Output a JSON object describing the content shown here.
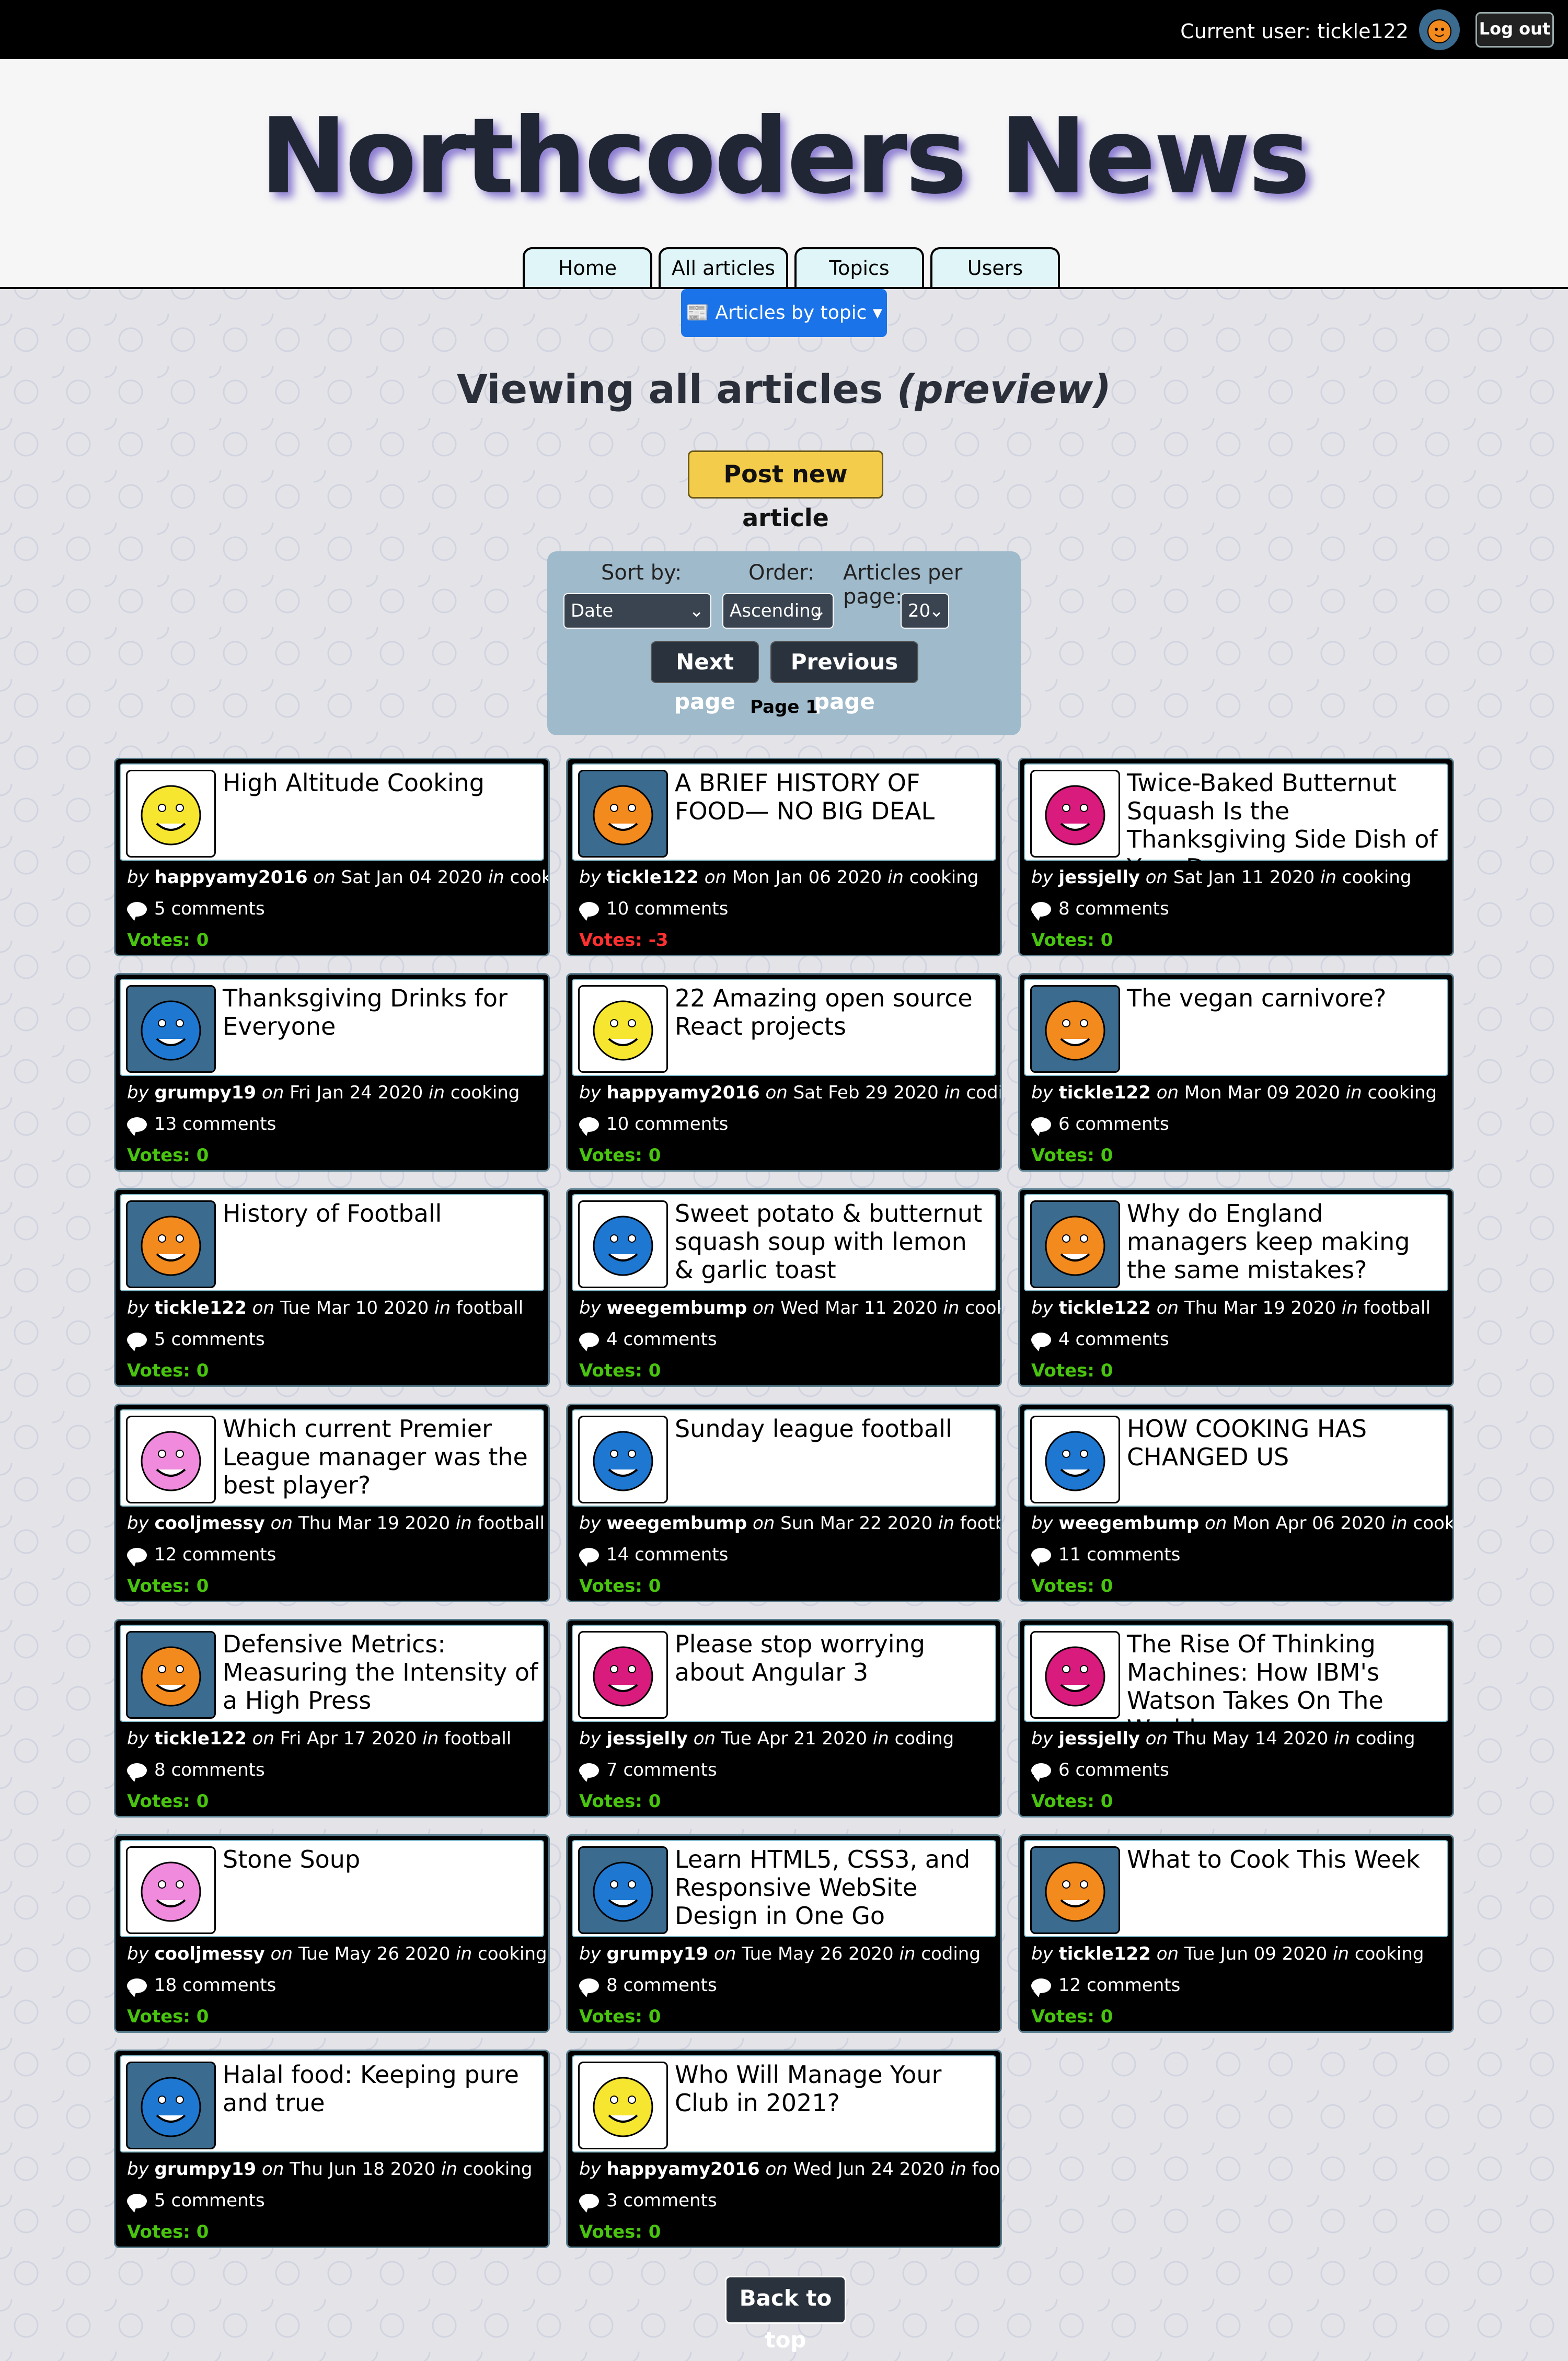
{
  "topbar": {
    "current_user": "Current user: tickle122",
    "logout_label": "Log out"
  },
  "header": {
    "title": "Northcoders News",
    "tabs": [
      "Home",
      "All articles",
      "Topics",
      "Users"
    ]
  },
  "topic_dropdown": {
    "label": "📰 Articles by topic ▾"
  },
  "page_heading": {
    "text": "Viewing all articles ",
    "emphasis": "(preview)"
  },
  "post_button": {
    "label": "Post new article"
  },
  "controls": {
    "sort_label": "Sort by:",
    "order_label": "Order:",
    "per_page_label": "Articles per page:",
    "sort_value": "Date",
    "order_value": "Ascending",
    "per_page_value": "20",
    "next_label": "Next page",
    "prev_label": "Previous page",
    "page_text": "Page 1"
  },
  "avatar_colors": {
    "happyamy2016": "#f7e630",
    "tickle122": "#f28a1e",
    "jessjelly": "#d81b7d",
    "grumpy19": "#1e78d2",
    "weegembump": "#1e78d2",
    "cooljmessy": "#f08adc"
  },
  "articles": [
    {
      "title": "High Altitude Cooking",
      "author": "happyamy2016",
      "date": "Sat Jan 04 2020",
      "topic": "cooking",
      "comments": "5 comments",
      "votes": "Votes: 0",
      "negative": false
    },
    {
      "title": "A BRIEF HISTORY OF FOOD— NO BIG DEAL",
      "author": "tickle122",
      "date": "Mon Jan 06 2020",
      "topic": "cooking",
      "comments": "10 comments",
      "votes": "Votes: -3",
      "negative": true
    },
    {
      "title": "Twice-Baked Butternut Squash Is the Thanksgiving Side Dish of Your Dreams",
      "author": "jessjelly",
      "date": "Sat Jan 11 2020",
      "topic": "cooking",
      "comments": "8 comments",
      "votes": "Votes: 0",
      "negative": false
    },
    {
      "title": "Thanksgiving Drinks for Everyone",
      "author": "grumpy19",
      "date": "Fri Jan 24 2020",
      "topic": "cooking",
      "comments": "13 comments",
      "votes": "Votes: 0",
      "negative": false
    },
    {
      "title": "22 Amazing open source React projects",
      "author": "happyamy2016",
      "date": "Sat Feb 29 2020",
      "topic": "coding",
      "comments": "10 comments",
      "votes": "Votes: 0",
      "negative": false
    },
    {
      "title": "The vegan carnivore?",
      "author": "tickle122",
      "date": "Mon Mar 09 2020",
      "topic": "cooking",
      "comments": "6 comments",
      "votes": "Votes: 0",
      "negative": false
    },
    {
      "title": "History of Football",
      "author": "tickle122",
      "date": "Tue Mar 10 2020",
      "topic": "football",
      "comments": "5 comments",
      "votes": "Votes: 0",
      "negative": false
    },
    {
      "title": "Sweet potato & butternut squash soup with lemon & garlic toast",
      "author": "weegembump",
      "date": "Wed Mar 11 2020",
      "topic": "cooking",
      "comments": "4 comments",
      "votes": "Votes: 0",
      "negative": false
    },
    {
      "title": "Why do England managers keep making the same mistakes?",
      "author": "tickle122",
      "date": "Thu Mar 19 2020",
      "topic": "football",
      "comments": "4 comments",
      "votes": "Votes: 0",
      "negative": false
    },
    {
      "title": "Which current Premier League manager was the best player?",
      "author": "cooljmessy",
      "date": "Thu Mar 19 2020",
      "topic": "football",
      "comments": "12 comments",
      "votes": "Votes: 0",
      "negative": false
    },
    {
      "title": "Sunday league football",
      "author": "weegembump",
      "date": "Sun Mar 22 2020",
      "topic": "football",
      "comments": "14 comments",
      "votes": "Votes: 0",
      "negative": false
    },
    {
      "title": "HOW COOKING HAS CHANGED US",
      "author": "weegembump",
      "date": "Mon Apr 06 2020",
      "topic": "cooking",
      "comments": "11 comments",
      "votes": "Votes: 0",
      "negative": false
    },
    {
      "title": "Defensive Metrics: Measuring the Intensity of a High Press",
      "author": "tickle122",
      "date": "Fri Apr 17 2020",
      "topic": "football",
      "comments": "8 comments",
      "votes": "Votes: 0",
      "negative": false
    },
    {
      "title": "Please stop worrying about Angular 3",
      "author": "jessjelly",
      "date": "Tue Apr 21 2020",
      "topic": "coding",
      "comments": "7 comments",
      "votes": "Votes: 0",
      "negative": false
    },
    {
      "title": "The Rise Of Thinking Machines: How IBM's Watson Takes On The World",
      "author": "jessjelly",
      "date": "Thu May 14 2020",
      "topic": "coding",
      "comments": "6 comments",
      "votes": "Votes: 0",
      "negative": false
    },
    {
      "title": "Stone Soup",
      "author": "cooljmessy",
      "date": "Tue May 26 2020",
      "topic": "cooking",
      "comments": "18 comments",
      "votes": "Votes: 0",
      "negative": false
    },
    {
      "title": "Learn HTML5, CSS3, and Responsive WebSite Design in One Go",
      "author": "grumpy19",
      "date": "Tue May 26 2020",
      "topic": "coding",
      "comments": "8 comments",
      "votes": "Votes: 0",
      "negative": false
    },
    {
      "title": "What to Cook This Week",
      "author": "tickle122",
      "date": "Tue Jun 09 2020",
      "topic": "cooking",
      "comments": "12 comments",
      "votes": "Votes: 0",
      "negative": false
    },
    {
      "title": "Halal food: Keeping pure and true",
      "author": "grumpy19",
      "date": "Thu Jun 18 2020",
      "topic": "cooking",
      "comments": "5 comments",
      "votes": "Votes: 0",
      "negative": false
    },
    {
      "title": "Who Will Manage Your Club in 2021?",
      "author": "happyamy2016",
      "date": "Wed Jun 24 2020",
      "topic": "football",
      "comments": "3 comments",
      "votes": "Votes: 0",
      "negative": false
    }
  ],
  "back_to_top": {
    "label": "Back to top"
  }
}
